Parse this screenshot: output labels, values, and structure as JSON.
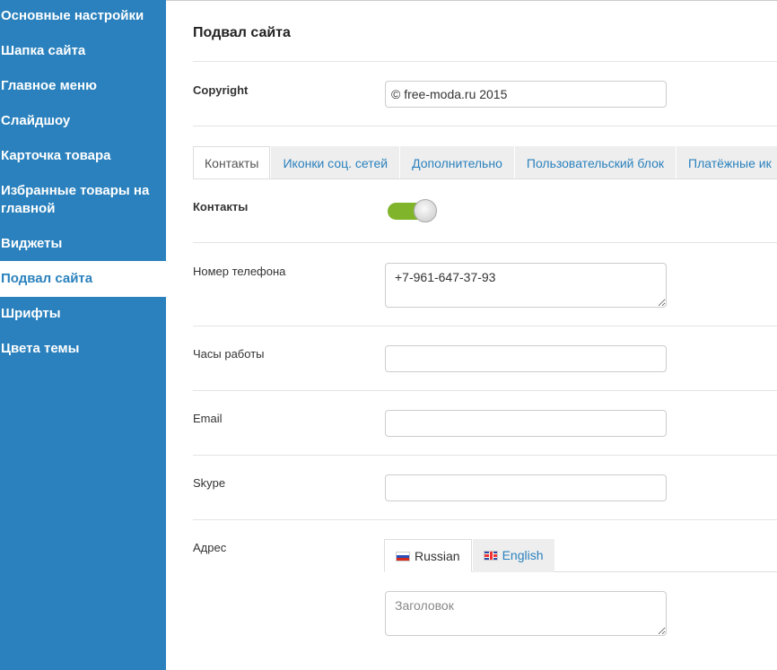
{
  "sidebar": {
    "items": [
      {
        "label": "Основные настройки"
      },
      {
        "label": "Шапка сайта"
      },
      {
        "label": "Главное меню"
      },
      {
        "label": "Слайдшоу"
      },
      {
        "label": "Карточка товара"
      },
      {
        "label": "Избранные товары на главной"
      },
      {
        "label": "Виджеты"
      },
      {
        "label": "Подвал сайта"
      },
      {
        "label": "Шрифты"
      },
      {
        "label": "Цвета темы"
      }
    ],
    "active_index": 7
  },
  "main": {
    "title": "Подвал сайта",
    "copyright": {
      "label": "Copyright",
      "value": "© free-moda.ru 2015"
    },
    "tabs": [
      {
        "label": "Контакты"
      },
      {
        "label": "Иконки соц. сетей"
      },
      {
        "label": "Дополнительно"
      },
      {
        "label": "Пользовательский блок"
      },
      {
        "label": "Платёжные ик"
      }
    ],
    "contacts": {
      "label": "Контакты",
      "enabled": true
    },
    "phone": {
      "label": "Номер телефона",
      "value": "+7-961-647-37-93"
    },
    "hours": {
      "label": "Часы работы",
      "value": ""
    },
    "email": {
      "label": "Email",
      "value": ""
    },
    "skype": {
      "label": "Skype",
      "value": ""
    },
    "address": {
      "label": "Адрес",
      "lang_tabs": [
        {
          "label": "Russian",
          "flag": "flag-ru"
        },
        {
          "label": "English",
          "flag": "flag-gb"
        }
      ],
      "placeholder": "Заголовок"
    }
  },
  "colors": {
    "sidebar_bg": "#2a81bd",
    "toggle_on": "#80b42b",
    "link": "#2a81bd"
  }
}
